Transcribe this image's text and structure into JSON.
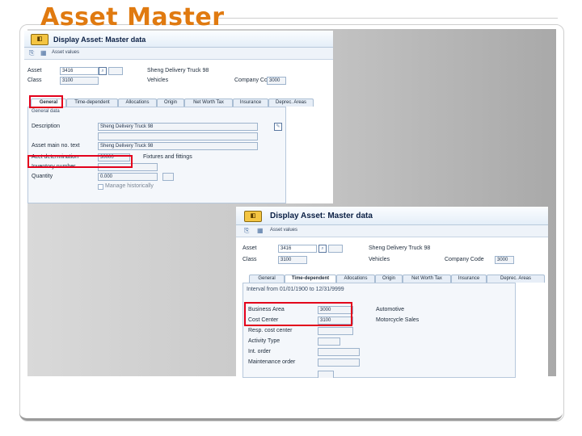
{
  "slide": {
    "title": "Asset Master"
  },
  "window1": {
    "title": "Display Asset: Master data",
    "toolbar": {
      "asset_values": "Asset values"
    },
    "header": {
      "asset_label": "Asset",
      "asset_value": "3416",
      "asset_desc": "Sheng Delivery Truck 98",
      "class_label": "Class",
      "class_value": "3100",
      "class_desc": "Vehicles",
      "company_code_label": "Company Code",
      "company_code_value": "3000"
    },
    "tabs": [
      "General",
      "Time-dependent",
      "Allocations",
      "Origin",
      "Net Worth Tax",
      "Insurance",
      "Deprec. Areas"
    ],
    "group_title": "General data",
    "fields": {
      "description_label": "Description",
      "description_value": "Sheng Delivery Truck 98",
      "asset_main_label": "Asset main no. text",
      "asset_main_value": "Sheng Delivery Truck 98",
      "acct_det_label": "Acct determination",
      "acct_det_value": "30000",
      "acct_det_desc": "Fixtures and fittings",
      "inventory_label": "Inventory number",
      "quantity_label": "Quantity",
      "quantity_value": "0.000",
      "manage_hist_label": "Manage historically"
    }
  },
  "window2": {
    "title": "Display Asset: Master data",
    "toolbar": {
      "asset_values": "Asset values"
    },
    "header": {
      "asset_label": "Asset",
      "asset_value": "3416",
      "asset_desc": "Sheng Delivery Truck 98",
      "class_label": "Class",
      "class_value": "3100",
      "class_desc": "Vehicles",
      "company_code_label": "Company Code",
      "company_code_value": "3000"
    },
    "tabs": [
      "General",
      "Time-dependent",
      "Allocations",
      "Origin",
      "Net Worth Tax",
      "Insurance",
      "Deprec. Areas"
    ],
    "interval": "Interval from 01/01/1900 to 12/31/9999",
    "fields": {
      "business_area_label": "Business Area",
      "business_area_value": "3000",
      "business_area_desc": "Automotive",
      "cost_center_label": "Cost Center",
      "cost_center_value": "3100",
      "cost_center_desc": "Motorcycle Sales",
      "resp_cc_label": "Resp. cost center",
      "activity_type_label": "Activity Type",
      "int_order_label": "Int. order",
      "maint_order_label": "Maintenance order"
    }
  }
}
